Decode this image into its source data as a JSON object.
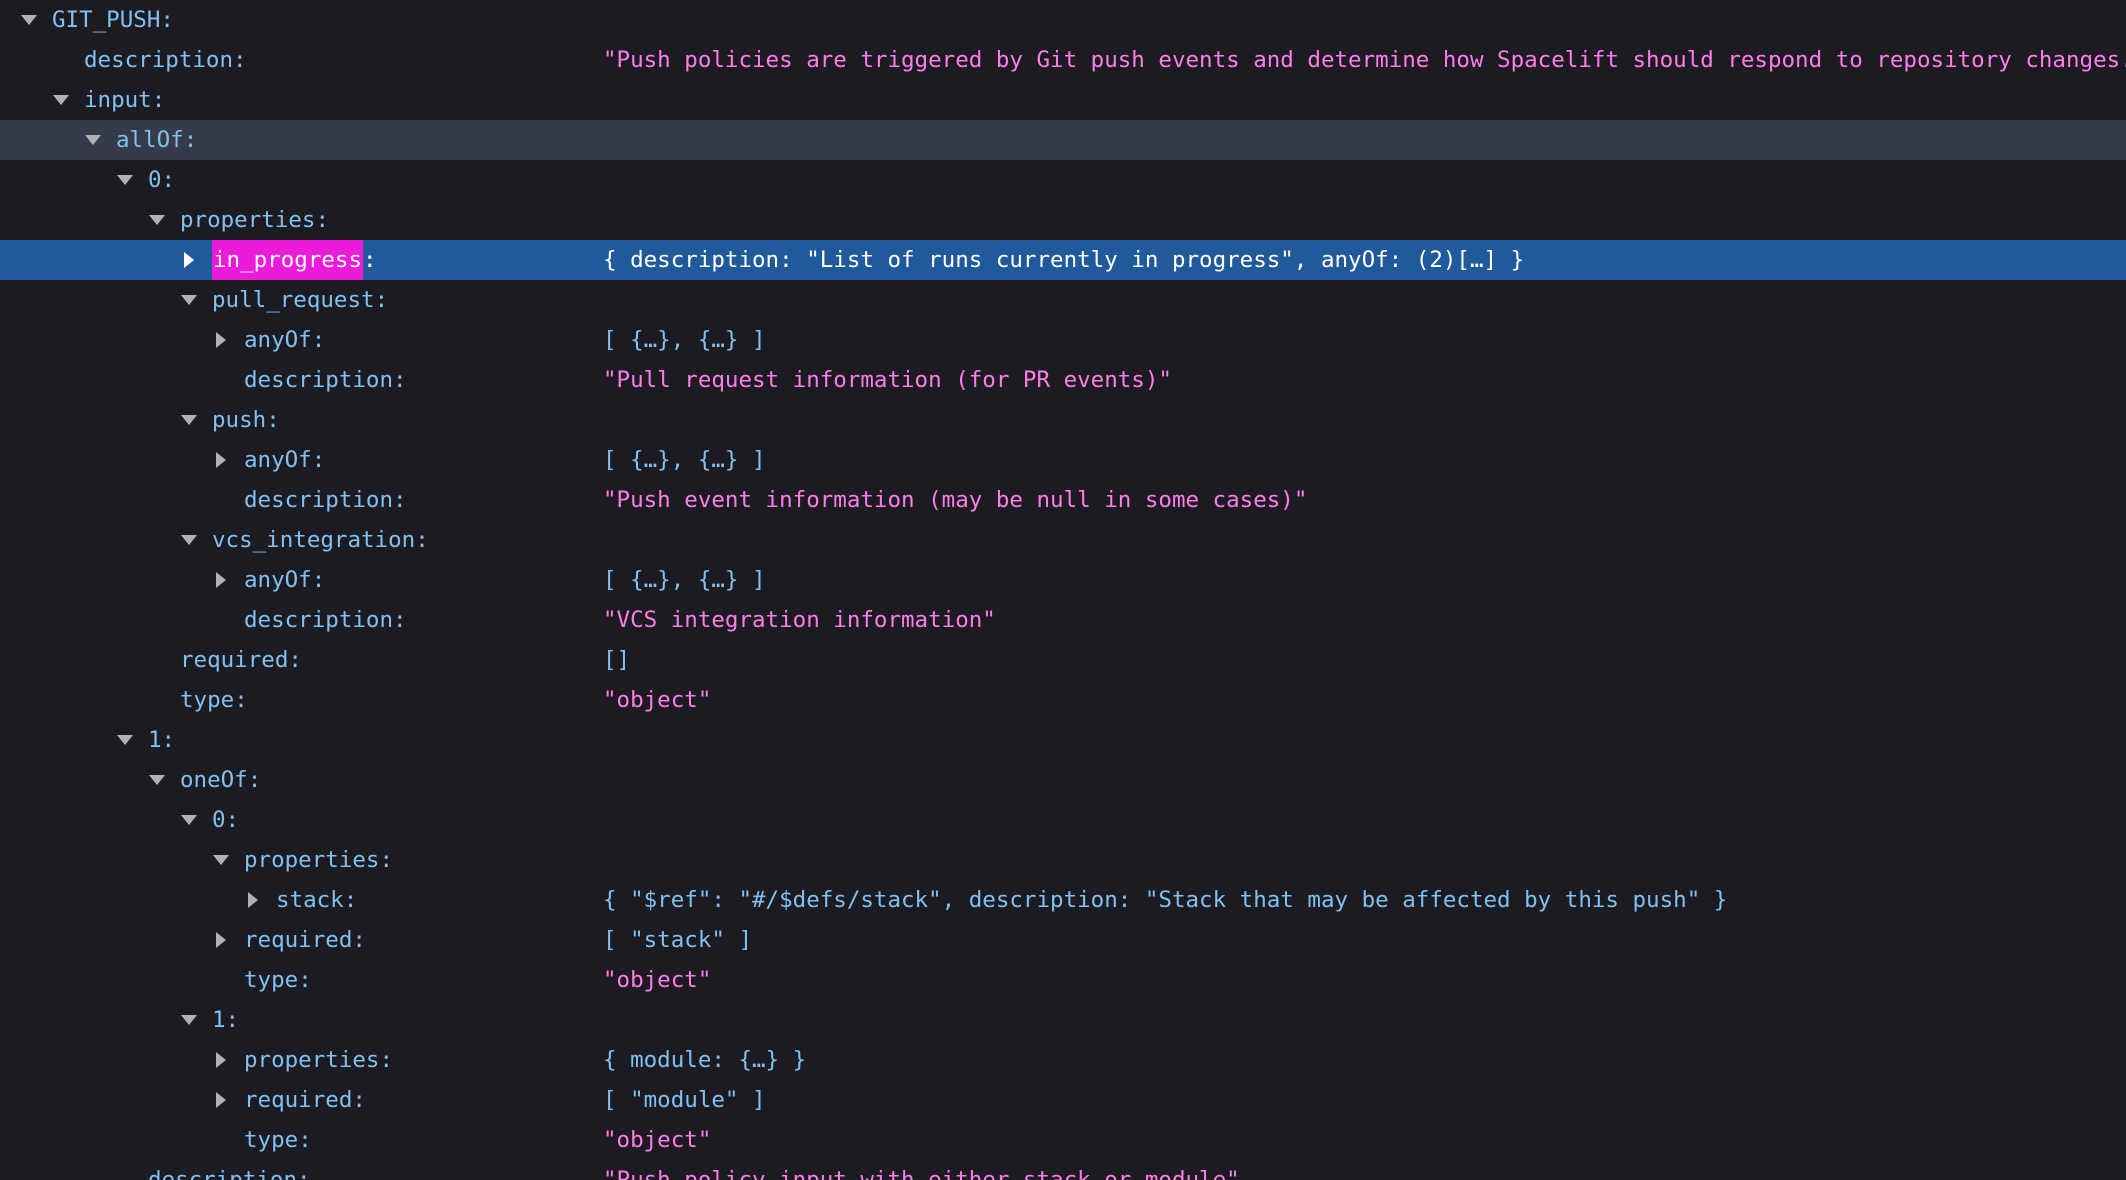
{
  "rows": [
    {
      "depth": 0,
      "toggle": "open",
      "key": "GIT_PUSH",
      "value": ""
    },
    {
      "depth": 1,
      "toggle": "none",
      "key": "description",
      "value": "\"Push policies are triggered by Git push events and determine how Spacelift should respond to repository changes.\"",
      "value_type": "string"
    },
    {
      "depth": 1,
      "toggle": "open",
      "key": "input",
      "value": ""
    },
    {
      "depth": 2,
      "toggle": "open",
      "key": "allOf",
      "value": "",
      "hovered": true
    },
    {
      "depth": 3,
      "toggle": "open",
      "key": "0",
      "value": ""
    },
    {
      "depth": 4,
      "toggle": "open",
      "key": "properties",
      "value": ""
    },
    {
      "depth": 5,
      "toggle": "closed",
      "key": "in_progress",
      "value": "{ description: \"List of runs currently in progress\", anyOf: (2)[…] }",
      "value_type": "object",
      "selected": true,
      "search_match": true
    },
    {
      "depth": 5,
      "toggle": "open",
      "key": "pull_request",
      "value": ""
    },
    {
      "depth": 6,
      "toggle": "closed",
      "key": "anyOf",
      "value": "[ {…}, {…} ]",
      "value_type": "object"
    },
    {
      "depth": 6,
      "toggle": "none",
      "key": "description",
      "value": "\"Pull request information (for PR events)\"",
      "value_type": "string"
    },
    {
      "depth": 5,
      "toggle": "open",
      "key": "push",
      "value": ""
    },
    {
      "depth": 6,
      "toggle": "closed",
      "key": "anyOf",
      "value": "[ {…}, {…} ]",
      "value_type": "object"
    },
    {
      "depth": 6,
      "toggle": "none",
      "key": "description",
      "value": "\"Push event information (may be null in some cases)\"",
      "value_type": "string"
    },
    {
      "depth": 5,
      "toggle": "open",
      "key": "vcs_integration",
      "value": ""
    },
    {
      "depth": 6,
      "toggle": "closed",
      "key": "anyOf",
      "value": "[ {…}, {…} ]",
      "value_type": "object"
    },
    {
      "depth": 6,
      "toggle": "none",
      "key": "description",
      "value": "\"VCS integration information\"",
      "value_type": "string"
    },
    {
      "depth": 4,
      "toggle": "none",
      "key": "required",
      "value": "[]",
      "value_type": "object"
    },
    {
      "depth": 4,
      "toggle": "none",
      "key": "type",
      "value": "\"object\"",
      "value_type": "string"
    },
    {
      "depth": 3,
      "toggle": "open",
      "key": "1",
      "value": ""
    },
    {
      "depth": 4,
      "toggle": "open",
      "key": "oneOf",
      "value": ""
    },
    {
      "depth": 5,
      "toggle": "open",
      "key": "0",
      "value": ""
    },
    {
      "depth": 6,
      "toggle": "open",
      "key": "properties",
      "value": ""
    },
    {
      "depth": 7,
      "toggle": "closed",
      "key": "stack",
      "value": "{ \"$ref\": \"#/$defs/stack\", description: \"Stack that may be affected by this push\" }",
      "value_type": "object"
    },
    {
      "depth": 6,
      "toggle": "closed",
      "key": "required",
      "value": "[ \"stack\" ]",
      "value_type": "object"
    },
    {
      "depth": 6,
      "toggle": "none",
      "key": "type",
      "value": "\"object\"",
      "value_type": "string"
    },
    {
      "depth": 5,
      "toggle": "open",
      "key": "1",
      "value": ""
    },
    {
      "depth": 6,
      "toggle": "closed",
      "key": "properties",
      "value": "{ module: {…} }",
      "value_type": "object"
    },
    {
      "depth": 6,
      "toggle": "closed",
      "key": "required",
      "value": "[ \"module\" ]",
      "value_type": "object"
    },
    {
      "depth": 6,
      "toggle": "none",
      "key": "type",
      "value": "\"object\"",
      "value_type": "string"
    },
    {
      "depth": 3,
      "toggle": "none",
      "key": "description",
      "value": "\"Push policy input with either stack or module\"",
      "value_type": "string"
    }
  ],
  "colors": {
    "background": "#1c1b22",
    "key": "#80c1f2",
    "string": "#ff7de9",
    "hover_row": "#353b48",
    "selected_row": "#215a9b",
    "search_highlight": "#ee1ad9"
  }
}
